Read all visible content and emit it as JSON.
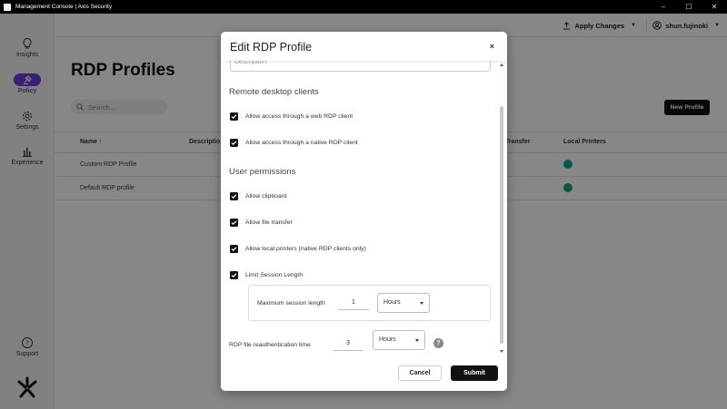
{
  "window": {
    "title": "Management Console | Axis Security",
    "controls": [
      "–",
      "☐",
      "✕"
    ]
  },
  "sidebar": {
    "items": [
      {
        "label": "Insights",
        "icon": "lightbulb-icon"
      },
      {
        "label": "Policy",
        "icon": "gavel-icon",
        "active": true
      },
      {
        "label": "Settings",
        "icon": "gear-icon"
      },
      {
        "label": "Experience",
        "icon": "bar-chart-icon"
      }
    ],
    "support_label": "Support"
  },
  "topbar": {
    "apply_changes": "Apply Changes",
    "username": "shun.fujinoki"
  },
  "page": {
    "title": "RDP Profiles",
    "search_placeholder": "Search...",
    "new_profile": "New Profile",
    "columns": {
      "name": "Name",
      "description": "Descriptio",
      "file_transfer": "e Transfer",
      "local_printers": "Local Printers"
    },
    "rows": [
      {
        "name": "Custom RDP Profile"
      },
      {
        "name": "Default RDP profile"
      }
    ]
  },
  "modal": {
    "title": "Edit RDP Profile",
    "close": "×",
    "description_placeholder": "Description",
    "remote_clients_title": "Remote desktop clients",
    "web_client": "Allow access through a web RDP client",
    "native_client": "Allow access through a native RDP client",
    "permissions_title": "User permissions",
    "clipboard": "Allow clipboard",
    "file_transfer": "Allow file transfer",
    "local_printers": "Allow local printers (native RDP clients only)",
    "limit_session": "Limit Session Length",
    "max_session_label": "Maximum session length",
    "max_session_value": "1",
    "max_session_unit": "Hours",
    "reauth_label": "RDP file reauthentication time",
    "reauth_value": "3",
    "reauth_unit": "Hours",
    "help": "?",
    "cancel": "Cancel",
    "submit": "Submit"
  }
}
